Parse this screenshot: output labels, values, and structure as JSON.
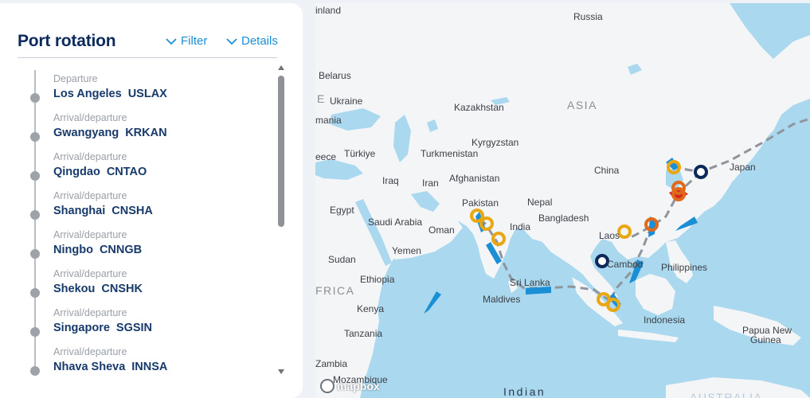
{
  "sidebar": {
    "title": "Port rotation",
    "filter_label": "Filter",
    "details_label": "Details",
    "stops": [
      {
        "kind": "Departure",
        "port": "Los Angeles",
        "code": "USLAX"
      },
      {
        "kind": "Arrival/departure",
        "port": "Gwangyang",
        "code": "KRKAN"
      },
      {
        "kind": "Arrival/departure",
        "port": "Qingdao",
        "code": "CNTAO"
      },
      {
        "kind": "Arrival/departure",
        "port": "Shanghai",
        "code": "CNSHA"
      },
      {
        "kind": "Arrival/departure",
        "port": "Ningbo",
        "code": "CNNGB"
      },
      {
        "kind": "Arrival/departure",
        "port": "Shekou",
        "code": "CNSHK"
      },
      {
        "kind": "Arrival/departure",
        "port": "Singapore",
        "code": "SGSIN"
      },
      {
        "kind": "Arrival/departure",
        "port": "Nhava Sheva",
        "code": "INNSA"
      }
    ]
  },
  "map": {
    "labels": {
      "finland": "inland",
      "russia": "Russia",
      "belarus": "Belarus",
      "ukraine": "Ukraine",
      "kazakhstan": "Kazakhstan",
      "asia": "ASIA",
      "romania": "mania",
      "turkiye": "Türkiye",
      "turkmenistan": "Turkmenistan",
      "kyrgyzstan": "Kyrgyzstan",
      "greece": "eece",
      "iraq": "Iraq",
      "iran": "Iran",
      "afghanistan": "Afghanistan",
      "china": "China",
      "japan": "Japan",
      "pakistan": "Pakistan",
      "egypt": "Egypt",
      "nepal": "Nepal",
      "saudi": "Saudi Arabia",
      "oman": "Oman",
      "india": "India",
      "bangladesh": "Bangladesh",
      "laos": "Laos",
      "sudan": "Sudan",
      "yemen": "Yemen",
      "cambodia": "Cambod",
      "philippines": "Philippines",
      "ethiopia": "Ethiopia",
      "africa": "FRICA",
      "srilanka": "Sri Lanka",
      "maldives": "Maldives",
      "kenya": "Kenya",
      "indonesia": "Indonesia",
      "tanzania": "Tanzania",
      "png": "Papua New",
      "png2": "Guinea",
      "zambia": "Zambia",
      "mozambique": "Mozambique",
      "indian": "Indian",
      "australia": "AUSTRALIA",
      "e": "E"
    },
    "attribution": "mapbox",
    "colors": {
      "water": "#a9d8ef",
      "land": "#f4f5f7",
      "route": "#8f959c",
      "port_yellow": "#e8a713",
      "port_orange": "#df6a1c",
      "port_navy": "#0b2a5b",
      "ship_blue": "#1b8fd6",
      "ship_red": "#d4261d"
    },
    "markers": [
      {
        "type": "port-yellow",
        "icon": "port-marker-icon"
      },
      {
        "type": "port-navy",
        "icon": "port-marker-icon"
      },
      {
        "type": "port-orange",
        "icon": "port-marker-icon"
      },
      {
        "type": "vessel",
        "icon": "vessel-icon"
      }
    ]
  }
}
